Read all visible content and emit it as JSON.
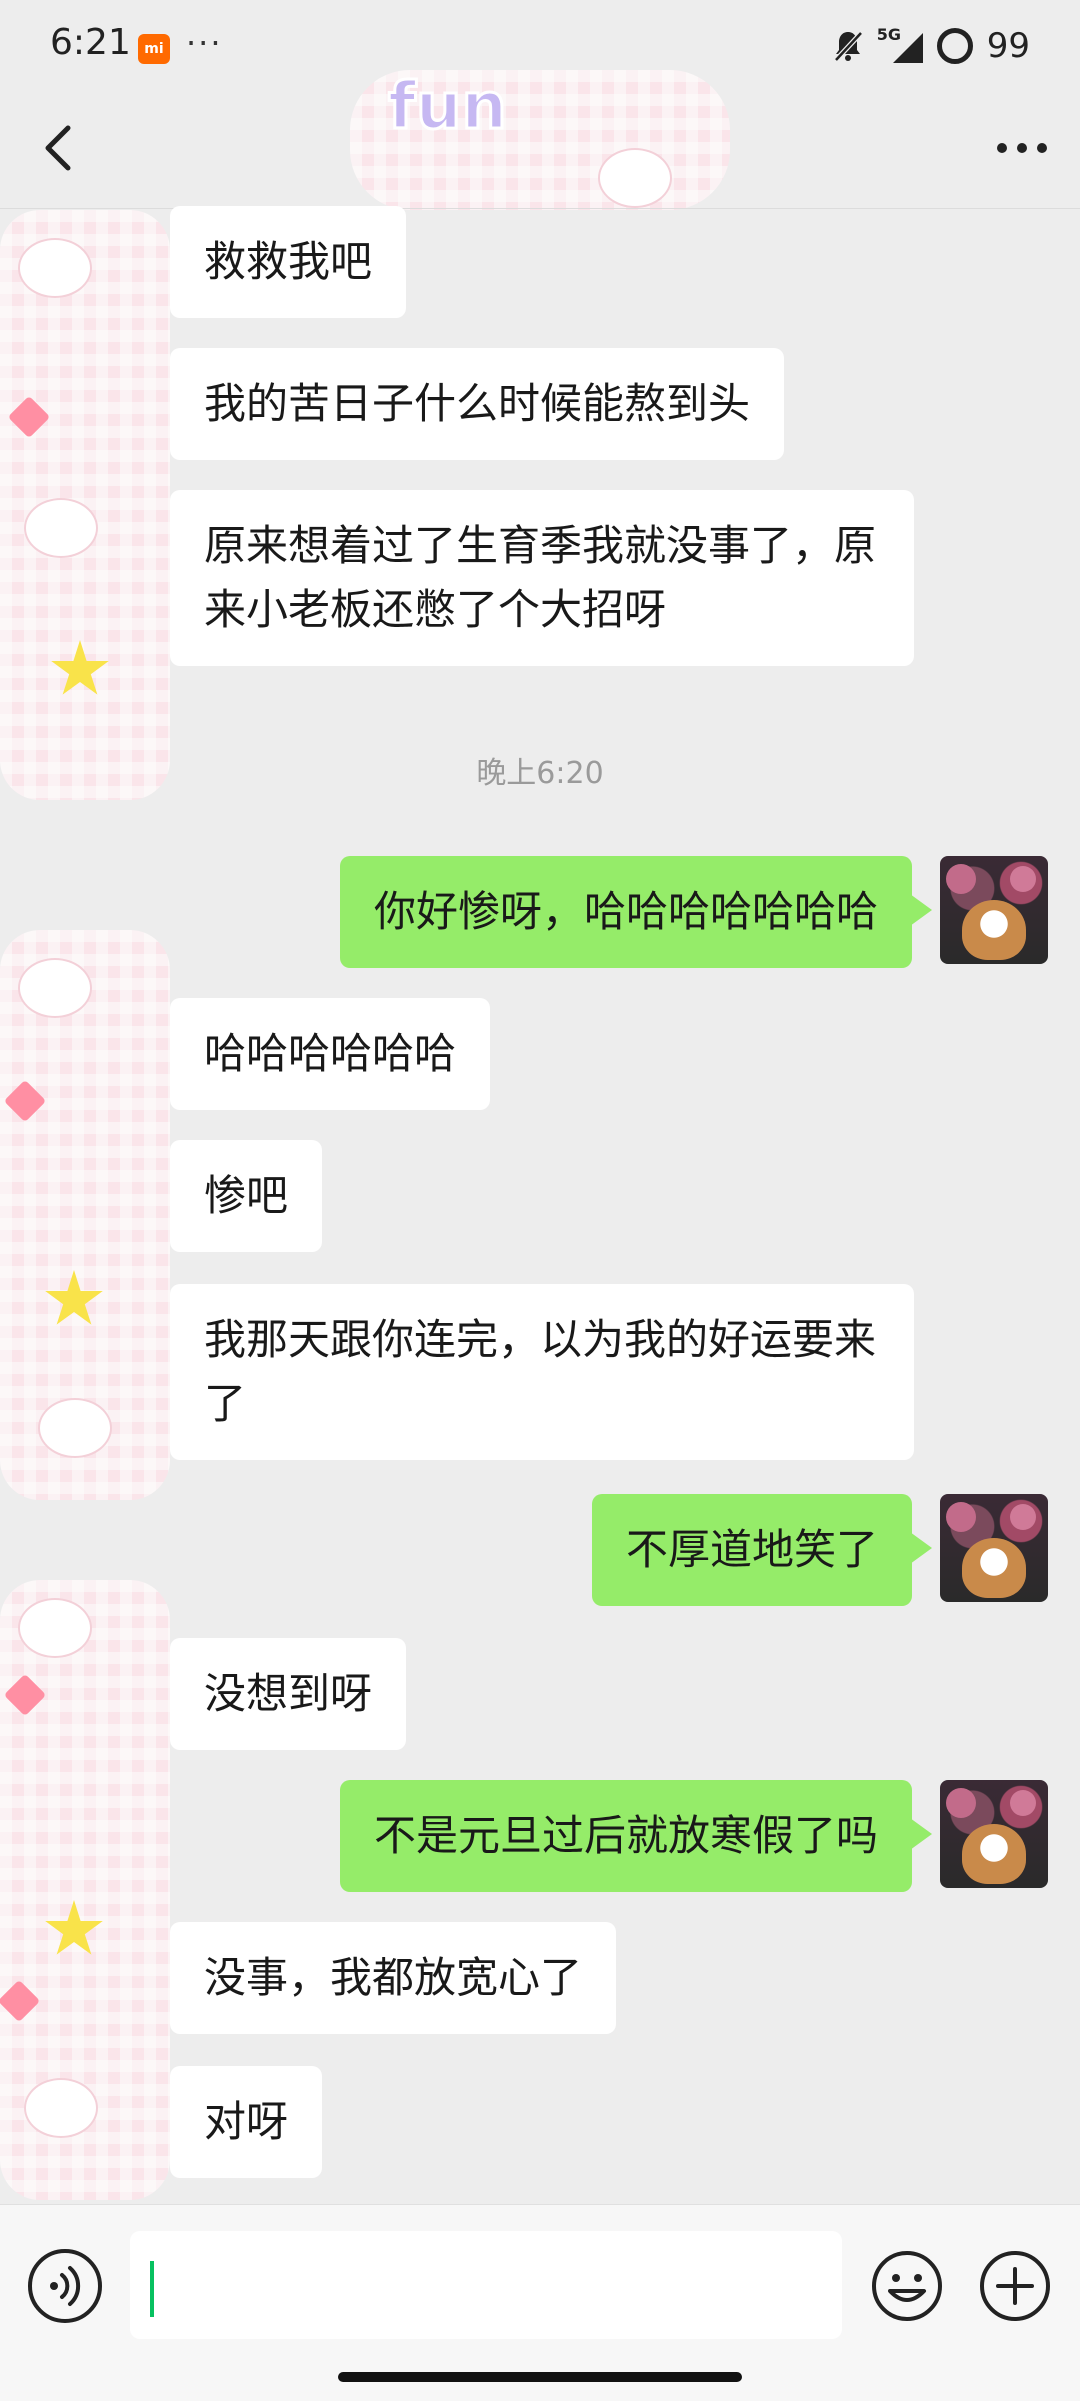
{
  "status_bar": {
    "time": "6:21",
    "app_badge": "mi",
    "more_indicator": "···",
    "network": "5G",
    "battery": "99",
    "icons": [
      "mute-icon",
      "signal-icon",
      "battery-ring-icon"
    ]
  },
  "header": {
    "back_icon": "chevron-left-icon",
    "more_icon": "more-dots-icon",
    "sticker_text": "fun"
  },
  "messages": [
    {
      "side": "left",
      "text": "救救我吧"
    },
    {
      "side": "left",
      "text": "我的苦日子什么时候能熬到头"
    },
    {
      "side": "left",
      "text": "原来想着过了生育季我就没事了，原来小老板还憋了个大招呀"
    },
    {
      "type": "time",
      "text": "晚上6:20"
    },
    {
      "side": "right",
      "text": "你好惨呀，哈哈哈哈哈哈哈"
    },
    {
      "side": "left",
      "text": "哈哈哈哈哈哈"
    },
    {
      "side": "left",
      "text": "惨吧"
    },
    {
      "side": "left",
      "text": "我那天跟你连完，以为我的好运要来了"
    },
    {
      "side": "right",
      "text": "不厚道地笑了"
    },
    {
      "side": "left",
      "text": "没想到呀"
    },
    {
      "side": "right",
      "text": "不是元旦过后就放寒假了吗"
    },
    {
      "side": "left",
      "text": "没事，我都放宽心了"
    },
    {
      "side": "left",
      "text": "对呀"
    }
  ],
  "input_bar": {
    "voice_icon": "voice-icon",
    "input_value": "",
    "emoji_icon": "emoji-icon",
    "plus_icon": "plus-icon"
  },
  "colors": {
    "background": "#ededed",
    "own_bubble": "#95ec69",
    "other_bubble": "#ffffff",
    "caret": "#07c160"
  }
}
